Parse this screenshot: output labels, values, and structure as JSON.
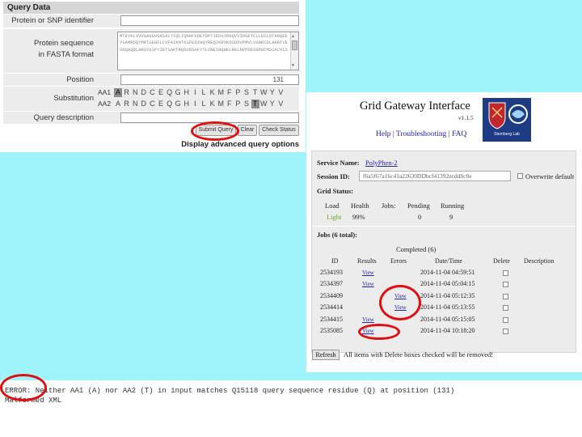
{
  "query_form": {
    "header": "Query Data",
    "identifier_label": "Protein or SNP identifier",
    "identifier_value": "",
    "sequence_label_line1": "Protein sequence",
    "sequence_label_line2": "in FASTA format",
    "sequence_value": "MTEYKLVVVGAGGVGKSALTIQLIQNHFVDEYDPTIEDSYRKQVVIDGETCLLDILDTAGQEEYSAMRDQYMRTGEGFLCVFAINNTKSFEDIHQYREQIKRVKDSDDVPMVLVGNKCDLAARTVESRQAQDLARSYGIPYIETSAKTRQGVEDAFYTLVREIRQHKLRKLNPPDESGPGCMSCKCVLS",
    "position_label": "Position",
    "position_value": "131",
    "substitution_label": "Substitution",
    "aa1_label": "AA1",
    "aa2_label": "AA2",
    "aa1_residues": [
      "A",
      "R",
      "N",
      "D",
      "C",
      "E",
      "Q",
      "G",
      "H",
      "I",
      "L",
      "K",
      "M",
      "F",
      "P",
      "S",
      "T",
      "W",
      "Y",
      "V"
    ],
    "aa2_residues": [
      "A",
      "R",
      "N",
      "D",
      "C",
      "E",
      "Q",
      "G",
      "H",
      "I",
      "L",
      "K",
      "M",
      "F",
      "P",
      "S",
      "T",
      "W",
      "Y",
      "V"
    ],
    "aa1_selected": "A",
    "aa2_selected": "T",
    "description_label": "Query description",
    "description_value": "",
    "submit_label": "Submit Query",
    "clear_label": "Clear",
    "check_status_label": "Check Status",
    "advanced_link": "Display advanced query options"
  },
  "grid_gateway": {
    "title": "Grid Gateway Interface",
    "version": "v1.1.5",
    "help_link": "Help",
    "troubleshooting_link": "Troubleshooting",
    "faq_link": "FAQ",
    "logo_text": "Sternberg Lab",
    "service_name_label": "Service Name:",
    "service_name_value": "PolyPhen-2",
    "session_id_label": "Session ID:",
    "session_id_value": "f6a5f67a16c41a22630DDbcf41392ecdd8c8e",
    "overwrite_label": "Overwrite default",
    "grid_status_label": "Grid Status:",
    "status_headers": [
      "Load",
      "Health",
      "Jobs:",
      "Pending",
      "Running"
    ],
    "status_values": [
      "Light",
      "99%",
      "",
      "0",
      "9"
    ],
    "jobs_title": "Jobs (6 total):",
    "completed_label": "Completed (6)",
    "columns": [
      "ID",
      "Results",
      "Errors",
      "Date/Time",
      "Delete",
      "Description"
    ],
    "rows": [
      {
        "id": "2534193",
        "results": "View",
        "errors": "",
        "datetime": "2014-11-04 04:59:51"
      },
      {
        "id": "2534397",
        "results": "View",
        "errors": "",
        "datetime": "2014-11-04 05:04:15"
      },
      {
        "id": "2534409",
        "results": "",
        "errors": "View",
        "datetime": "2014-11-04 05:12:35"
      },
      {
        "id": "2534414",
        "results": "",
        "errors": "View",
        "datetime": "2014-11-04 05:13:55"
      },
      {
        "id": "2534415",
        "results": "View",
        "errors": "",
        "datetime": "2014-11-04 05:15:05"
      },
      {
        "id": "2535085",
        "results": "View",
        "errors": "",
        "datetime": "2014-11-04 10:18:20"
      }
    ],
    "refresh_label": "Refresh",
    "refresh_note": "All items with Delete boxes checked will be removed!"
  },
  "error_output": {
    "line1": "ERROR: Neither AA1 (A) nor AA2 (T) in input matches Q15118 query sequence residue (Q) at position (131)",
    "line2": "Malformed XML"
  },
  "colors": {
    "page_background": "#9ff3fb",
    "highlight_ring": "#e01010",
    "link": "#2222aa",
    "health_light": "#66aa33"
  }
}
